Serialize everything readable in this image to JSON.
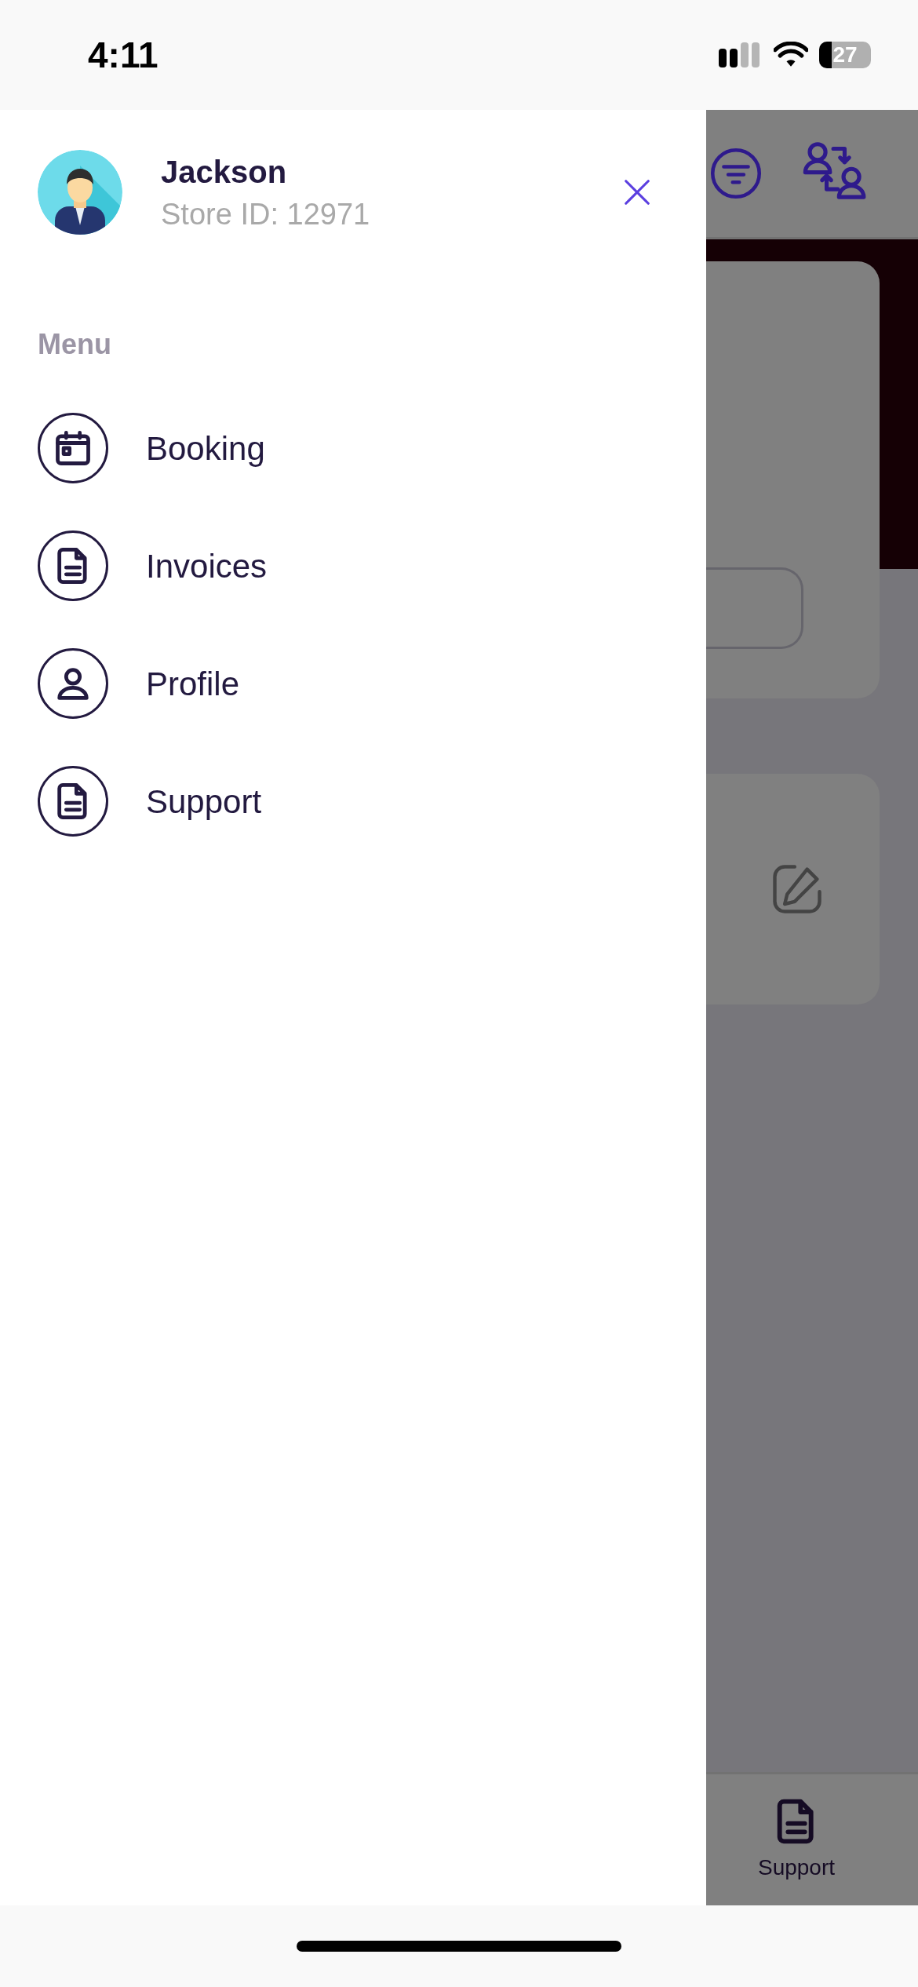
{
  "status_bar": {
    "time": "4:11",
    "battery": "27"
  },
  "drawer": {
    "user": {
      "name": "Jackson",
      "store_id": "Store ID: 12971"
    },
    "menu_heading": "Menu",
    "items": [
      {
        "label": "Booking",
        "kind": "calendar"
      },
      {
        "label": "Invoices",
        "kind": "document"
      },
      {
        "label": "Profile",
        "kind": "person"
      },
      {
        "label": "Support",
        "kind": "document"
      }
    ]
  },
  "background": {
    "bottom_nav": [
      {
        "label": "Support",
        "kind": "document"
      }
    ]
  }
}
